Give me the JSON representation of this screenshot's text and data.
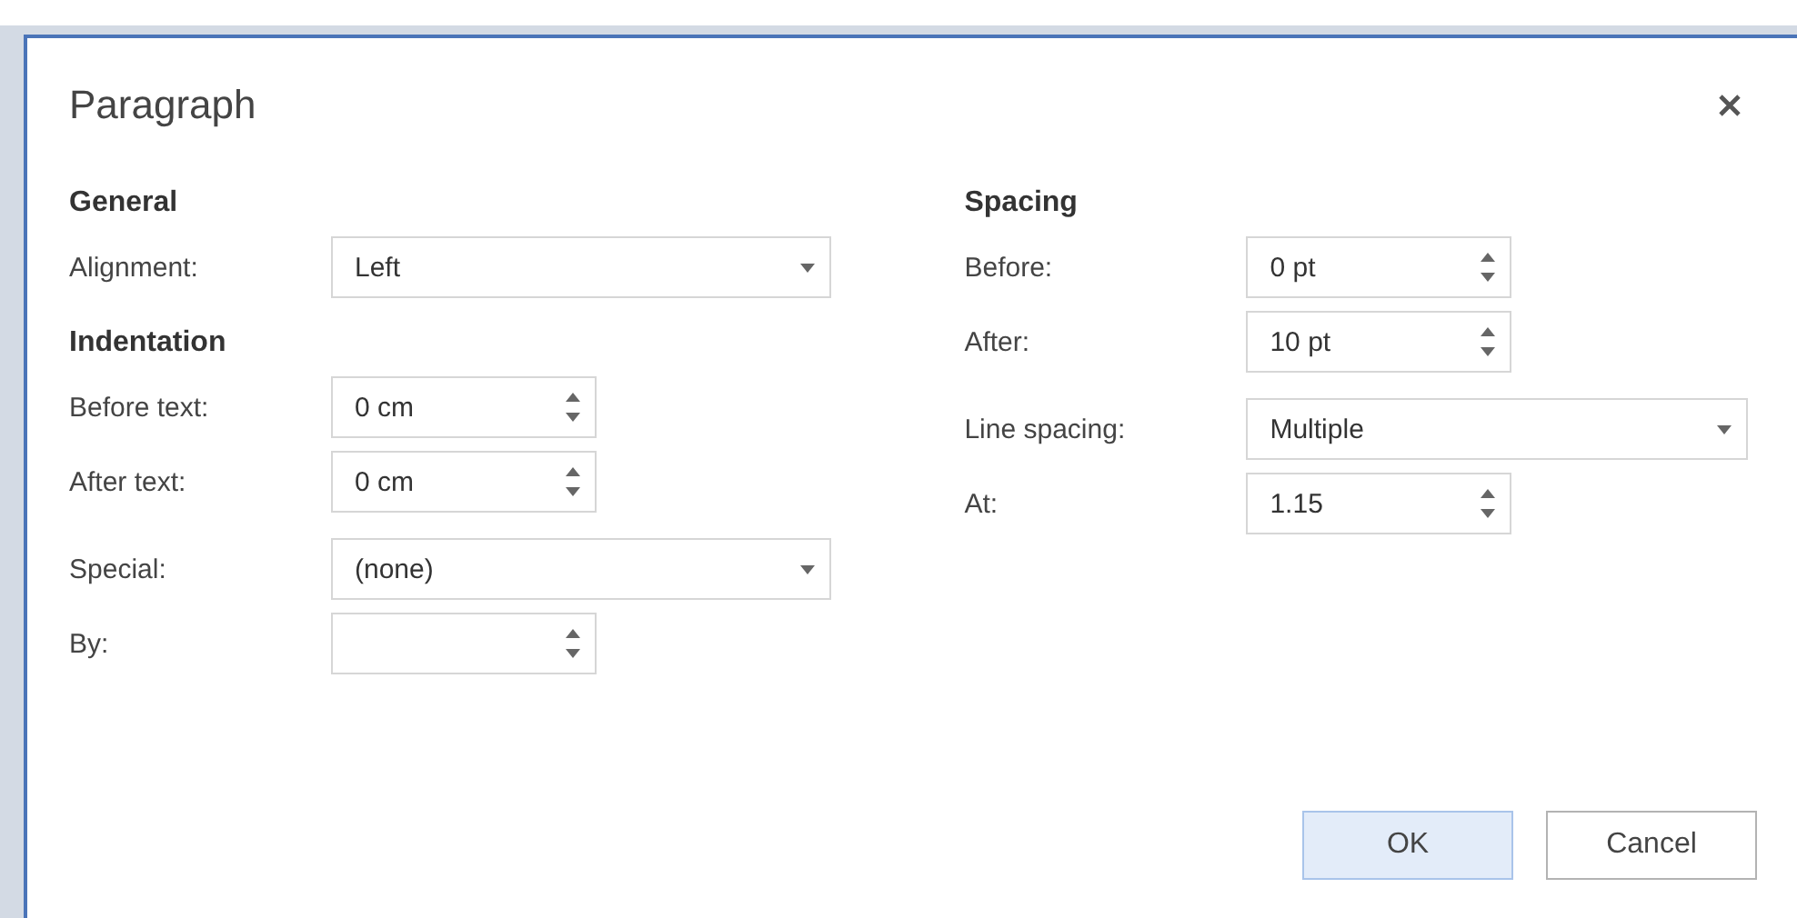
{
  "dialog": {
    "title": "Paragraph",
    "columns": [
      {
        "groups": [
          {
            "heading": "General",
            "rows": [
              {
                "label": "Alignment:",
                "kind": "select",
                "value": "Left"
              }
            ]
          },
          {
            "heading": "Indentation",
            "rows": [
              {
                "label": "Before text:",
                "kind": "spin",
                "value": "0 cm"
              },
              {
                "label": "After text:",
                "kind": "spin",
                "value": "0 cm"
              }
            ]
          },
          {
            "rows": [
              {
                "label": "Special:",
                "kind": "select",
                "value": "(none)"
              },
              {
                "label": "By:",
                "kind": "spin",
                "value": ""
              }
            ]
          }
        ]
      },
      {
        "groups": [
          {
            "heading": "Spacing",
            "rows": [
              {
                "label": "Before:",
                "kind": "spin",
                "value": "0 pt"
              },
              {
                "label": "After:",
                "kind": "spin",
                "value": "10 pt"
              }
            ]
          },
          {
            "rows": [
              {
                "label": "Line spacing:",
                "kind": "select",
                "value": "Multiple"
              },
              {
                "label": "At:",
                "kind": "spin",
                "value": "1.15"
              }
            ]
          }
        ]
      }
    ],
    "buttons": [
      {
        "label": "OK",
        "default": true
      },
      {
        "label": "Cancel",
        "default": false
      }
    ]
  }
}
